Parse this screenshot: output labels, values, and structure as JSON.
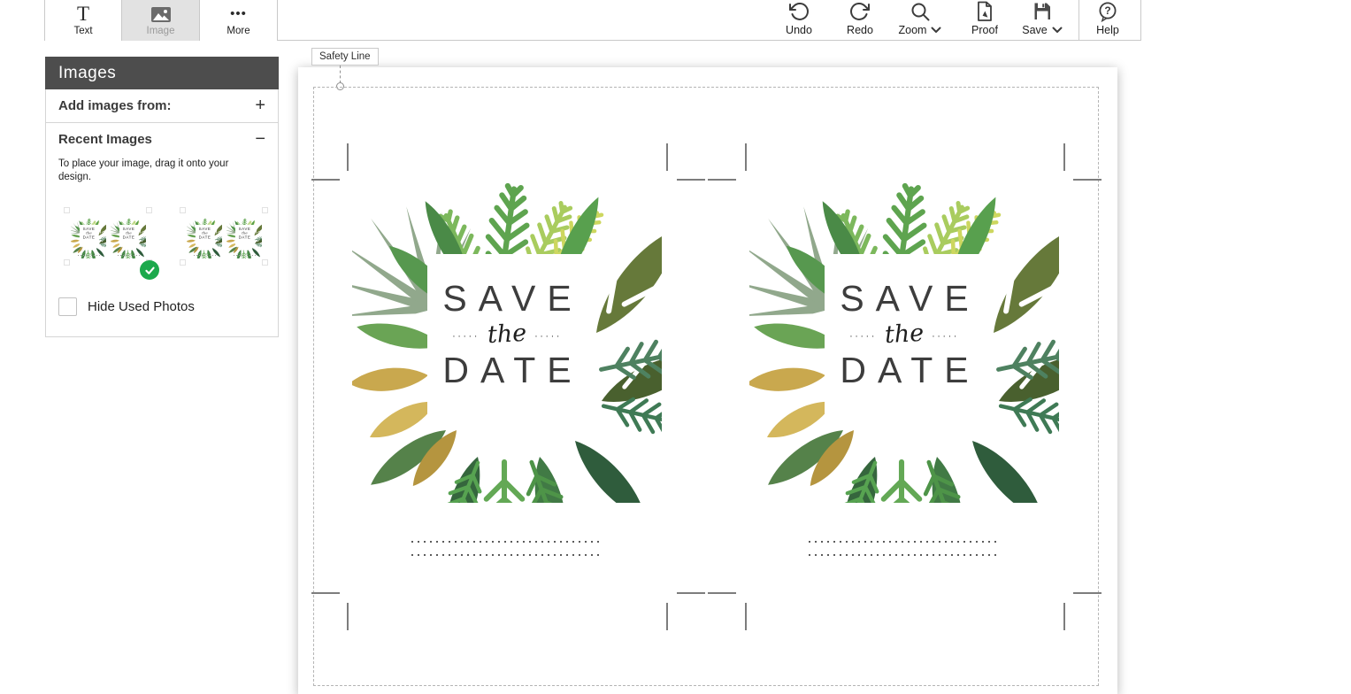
{
  "toolbar": {
    "text_label": "Text",
    "image_label": "Image",
    "more_label": "More",
    "undo_label": "Undo",
    "redo_label": "Redo",
    "zoom_label": "Zoom",
    "proof_label": "Proof",
    "save_label": "Save",
    "help_label": "Help",
    "text_glyph": "T",
    "more_glyph": "•••",
    "help_glyph": "?"
  },
  "sidebar": {
    "title": "Images",
    "add_images_label": "Add images from:",
    "add_toggle_glyph": "+",
    "recent_images_label": "Recent Images",
    "recent_toggle_glyph": "−",
    "helper_text": "To place your image, drag it onto your design.",
    "hide_used_label": "Hide Used Photos",
    "hide_used_checked": false,
    "thumbnail_count": 2,
    "first_thumbnail_used": true
  },
  "canvas": {
    "safety_line_label": "Safety Line",
    "card": {
      "line1": "SAVE",
      "dots": "·····",
      "the": "the",
      "line3": "DATE"
    }
  },
  "colors": {
    "panel_header": "#4d4d4d",
    "used_badge_green": "#1ca94c",
    "active_button_bg": "#e2e2e2",
    "crop_mark": "#7d7d7d",
    "leaf_greens": [
      "#5ea44f",
      "#7cb85c",
      "#a9cc5e",
      "#66793a",
      "#2f5c3c",
      "#417a45"
    ],
    "leaf_gold": "#c9a84e"
  }
}
